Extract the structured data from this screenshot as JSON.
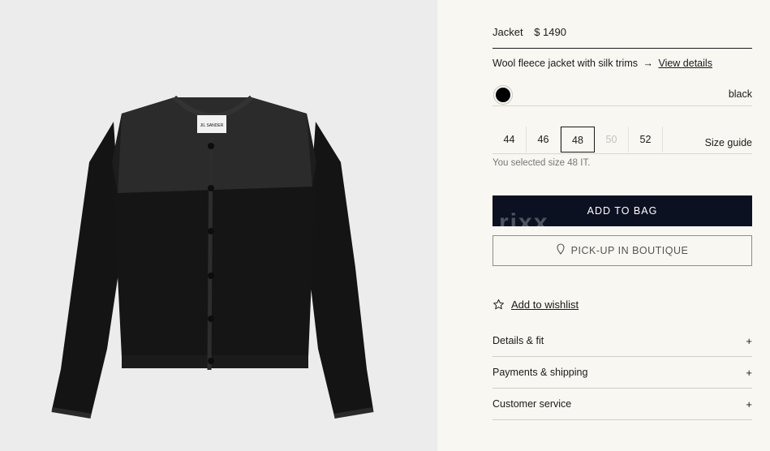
{
  "product": {
    "name": "Jacket",
    "price": "$ 1490",
    "description": "Wool fleece jacket with silk trims",
    "arrow": "→",
    "details_link": "View details",
    "brand_label": "JIL SANDER"
  },
  "color": {
    "name": "black",
    "swatch": "#000000"
  },
  "sizes": {
    "options": [
      "44",
      "46",
      "48",
      "50",
      "52"
    ],
    "selected": "48",
    "unavailable": [
      "50"
    ],
    "guide_label": "Size guide",
    "selected_note": "You selected size 48 IT."
  },
  "actions": {
    "add_to_bag": "ADD TO BAG",
    "pickup": "PICK-UP IN BOUTIQUE",
    "wishlist": "Add to wishlist"
  },
  "accordion": [
    {
      "label": "Details & fit",
      "icon": "+"
    },
    {
      "label": "Payments & shipping",
      "icon": "+"
    },
    {
      "label": "Customer service",
      "icon": "+"
    }
  ],
  "watermark": "rixx",
  "colors": {
    "bag_button": "#0c1122",
    "panel_bg": "#f8f7f1",
    "image_bg": "#ececec"
  }
}
